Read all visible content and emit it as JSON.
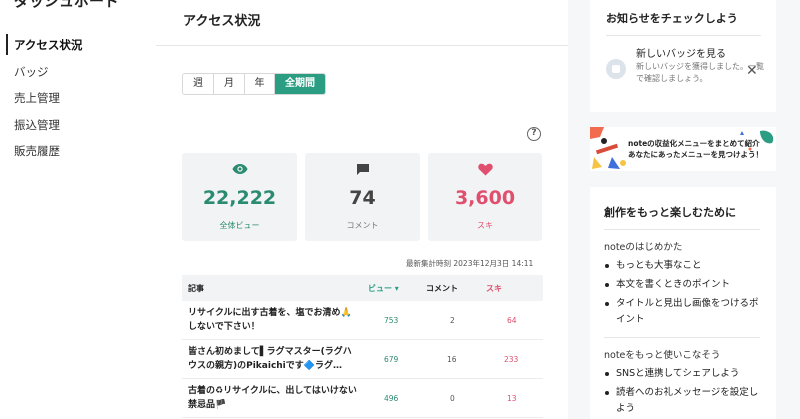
{
  "sidebar": {
    "brand": "ダッシュボード",
    "items": [
      {
        "label": "アクセス状況"
      },
      {
        "label": "バッジ"
      },
      {
        "label": "売上管理"
      },
      {
        "label": "振込管理"
      },
      {
        "label": "販売履歴"
      }
    ]
  },
  "main": {
    "title": "アクセス状況",
    "periods": [
      {
        "label": "週"
      },
      {
        "label": "月"
      },
      {
        "label": "年"
      },
      {
        "label": "全期間"
      }
    ],
    "active_period": "全期間",
    "help_label": "?",
    "stats": [
      {
        "icon": "eye-icon",
        "value": "22,222",
        "label": "全体ビュー",
        "color": "#2a8b70"
      },
      {
        "icon": "comment-icon",
        "value": "74",
        "label": "コメント",
        "color": "#444444"
      },
      {
        "icon": "heart-icon",
        "value": "3,600",
        "label": "スキ",
        "color": "#e04f6e"
      }
    ],
    "updated": "最新集計時刻 2023年12月3日 14:11",
    "table": {
      "headers": {
        "article": "記事",
        "views": "ビュー ▾",
        "comments": "コメント",
        "likes": "スキ"
      },
      "rows": [
        {
          "title": "リサイクルに出す古着を、塩でお清め🙏しないで下さい！",
          "views": "753",
          "comments": "2",
          "likes": "64"
        },
        {
          "title": "皆さん初めまして▌ラグマスター(ラグハウスの親方)のPikaichiです🔷ラグ…",
          "views": "679",
          "comments": "16",
          "likes": "233"
        },
        {
          "title": "古着の♻リサイクルに、出してはいけない禁忌品🏴",
          "views": "496",
          "comments": "0",
          "likes": "13"
        }
      ]
    }
  },
  "notice": {
    "heading": "お知らせをチェックしよう",
    "item_title": "新しいバッジを見る",
    "item_desc": "新しいバッジを獲得しました。一覧で確認しましょう。",
    "close": "✕"
  },
  "banner": {
    "line1": "noteの収益化メニューをまとめて紹介",
    "line2": "あなたにあったメニューを見つけよう！"
  },
  "guide": {
    "heading": "創作をもっと楽しむために",
    "section1": "noteのはじめかた",
    "items1": [
      "もっとも大事なこと",
      "本文を書くときのポイント",
      "タイトルと見出し画像をつけるポイント"
    ],
    "section2": "noteをもっと使いこなそう",
    "items2": [
      "SNSと連携してシェアしよう",
      "読者へのお礼メッセージを設定しよう"
    ]
  },
  "colors": {
    "accent": "#2a9d82",
    "like": "#e04f6e",
    "view": "#2a8b70"
  }
}
